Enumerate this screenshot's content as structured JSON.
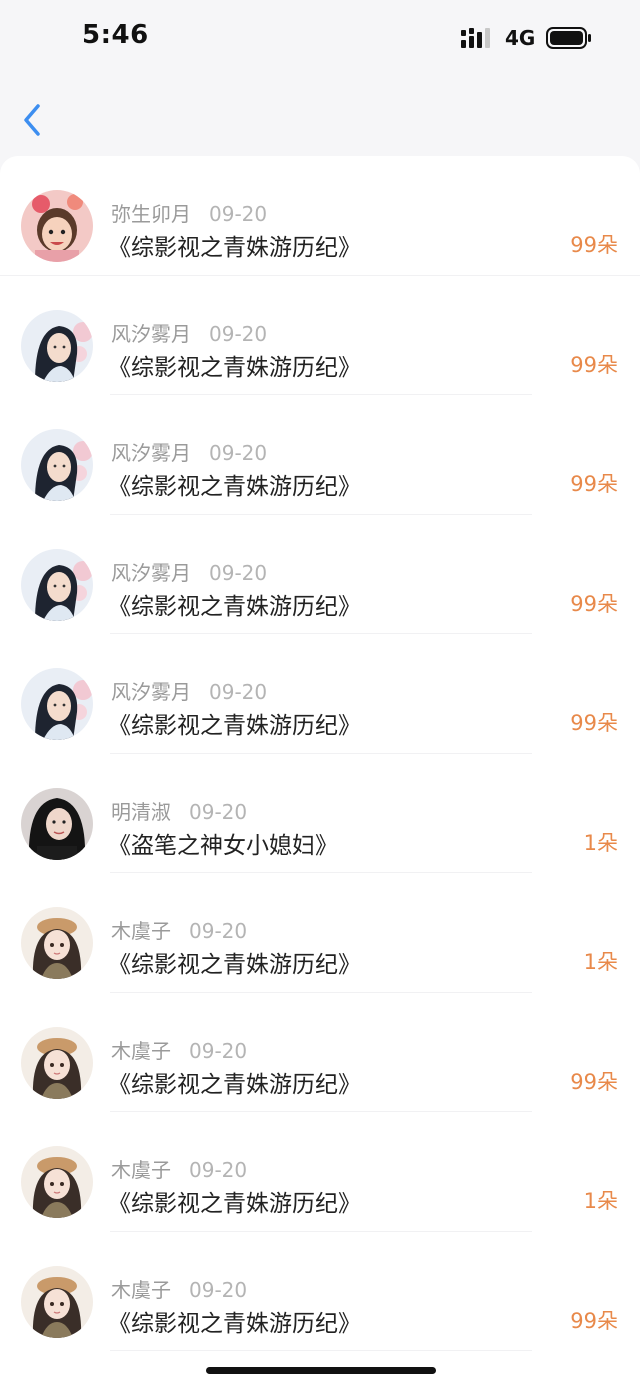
{
  "status_bar": {
    "time": "5:46",
    "network": "4G",
    "signal_icon": "cellular-signal-icon",
    "battery_icon": "battery-icon"
  },
  "nav": {
    "back_icon": "chevron-left-icon",
    "accent_color": "#3d8ef0"
  },
  "amount_color": "#e8894a",
  "items": [
    {
      "name": "弥生卯月",
      "date": "09-20",
      "title": "《综影视之青姝游历纪》",
      "amount": "99朵",
      "avatar": "child-portrait-avatar"
    },
    {
      "name": "风汐雾月",
      "date": "09-20",
      "title": "《综影视之青姝游历纪》",
      "amount": "99朵",
      "avatar": "costume-portrait-avatar"
    },
    {
      "name": "风汐雾月",
      "date": "09-20",
      "title": "《综影视之青姝游历纪》",
      "amount": "99朵",
      "avatar": "costume-portrait-avatar"
    },
    {
      "name": "风汐雾月",
      "date": "09-20",
      "title": "《综影视之青姝游历纪》",
      "amount": "99朵",
      "avatar": "costume-portrait-avatar"
    },
    {
      "name": "风汐雾月",
      "date": "09-20",
      "title": "《综影视之青姝游历纪》",
      "amount": "99朵",
      "avatar": "costume-portrait-avatar"
    },
    {
      "name": "明清淑",
      "date": "09-20",
      "title": "《盗笔之神女小媳妇》",
      "amount": "1朵",
      "avatar": "dark-portrait-avatar"
    },
    {
      "name": "木虞子",
      "date": "09-20",
      "title": "《综影视之青姝游历纪》",
      "amount": "1朵",
      "avatar": "illustrated-girl-avatar"
    },
    {
      "name": "木虞子",
      "date": "09-20",
      "title": "《综影视之青姝游历纪》",
      "amount": "99朵",
      "avatar": "illustrated-girl-avatar"
    },
    {
      "name": "木虞子",
      "date": "09-20",
      "title": "《综影视之青姝游历纪》",
      "amount": "1朵",
      "avatar": "illustrated-girl-avatar"
    },
    {
      "name": "木虞子",
      "date": "09-20",
      "title": "《综影视之青姝游历纪》",
      "amount": "99朵",
      "avatar": "illustrated-girl-avatar"
    }
  ]
}
